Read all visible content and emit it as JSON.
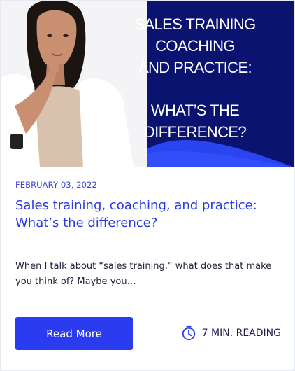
{
  "hero": {
    "title_lines": [
      "SALES TRAINING",
      "COACHING",
      "AND PRACTICE:",
      "WHAT’S THE",
      "DIFFERENCE?"
    ],
    "image_description_icon": "woman-thinking-image"
  },
  "post": {
    "date": "FEBRUARY 03, 2022",
    "title": "Sales training, coaching, and practice: What’s the difference?",
    "excerpt": "When I talk about “sales training,” what does that make you think of? Maybe you…",
    "read_more_label": "Read More",
    "reading_time": "7 MIN. READING",
    "reading_icon": "clock-icon"
  },
  "colors": {
    "hero_bg": "#0b1370",
    "accent": "#2b3cf0",
    "title": "#2a3be0"
  }
}
